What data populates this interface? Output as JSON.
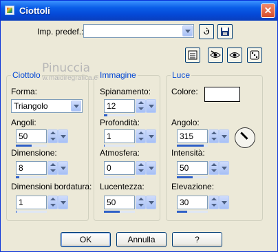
{
  "window": {
    "title": "Ciottoli",
    "close_glyph": "✕"
  },
  "toolbar": {
    "preset_label": "Imp. predef.:",
    "preset_value": "",
    "icons": [
      "reset-icon",
      "save-preset-icon",
      "list-icon",
      "eye-toggle-icon",
      "eye-icon",
      "random-dice-icon"
    ]
  },
  "watermark": {
    "line1": "Pinuccia",
    "line2": "www.maidiregrafica.eu"
  },
  "groups": {
    "ciottolo": {
      "title": "Ciottolo",
      "forma_label": "Forma:",
      "forma_value": "Triangolo",
      "angoli_label": "Angoli:",
      "angoli_value": "50",
      "dimensione_label": "Dimensione:",
      "dimensione_value": "8",
      "dim_bordatura_label": "Dimensioni bordatura:",
      "dim_bordatura_value": "1"
    },
    "immagine": {
      "title": "Immagine",
      "spianamento_label": "Spianamento:",
      "spianamento_value": "12",
      "profondita_label": "Profondità:",
      "profondita_value": "1",
      "atmosfera_label": "Atmosfera:",
      "atmosfera_value": "0",
      "lucentezza_label": "Lucentezza:",
      "lucentezza_value": "50"
    },
    "luce": {
      "title": "Luce",
      "colore_label": "Colore:",
      "colore_value": "#ffffff",
      "angolo_label": "Angolo:",
      "angolo_value": "315",
      "intensita_label": "Intensità:",
      "intensita_value": "50",
      "elevazione_label": "Elevazione:",
      "elevazione_value": "30"
    }
  },
  "fills": {
    "angoli": 0.5,
    "dimensione": 0.12,
    "dim_bordatura": 0.02,
    "spianamento": 0.12,
    "profondita": 0.02,
    "atmosfera": 0.0,
    "lucentezza": 0.5,
    "angolo": 0.875,
    "intensita": 0.5,
    "elevazione": 0.33
  },
  "buttons": {
    "ok": "OK",
    "cancel": "Annulla",
    "help": "?"
  },
  "colors": {
    "accent": "#0046d5",
    "titlebar": "#0548d6",
    "fill": "#2d5fc8"
  }
}
